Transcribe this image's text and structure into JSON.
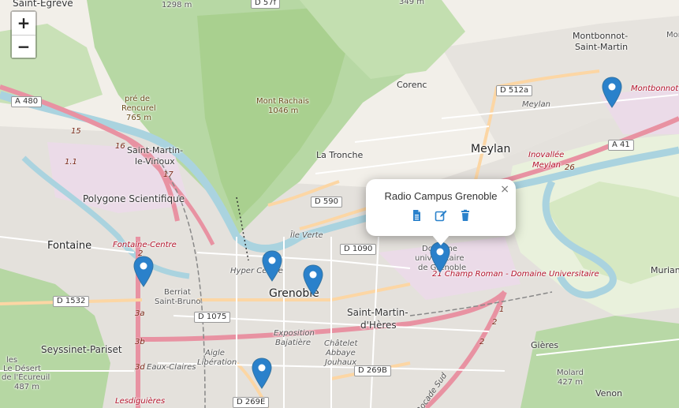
{
  "map": {
    "zoom_in_label": "+",
    "zoom_out_label": "−",
    "colors": {
      "marker": "#2a81cb",
      "marker_dark": "#3274a3",
      "motorway": "#e892a2",
      "trunk": "#f9b29c",
      "forest": "#add19e",
      "water": "#aad3df",
      "urban": "#e0dfdf"
    }
  },
  "labels": {
    "saint_egreve": "Saint-Égrève",
    "alt_1298": "1298 m",
    "d57f": "D 57f",
    "alt_349": "349 m",
    "mont_fragment": "Mont",
    "montbonnot": "Montbonnot-",
    "saint_martin": "Saint-Martin",
    "a480": "A 480",
    "pre_de": "pré de",
    "rencurel": "Rencurel",
    "alt_765": "765 m",
    "mont_rachais": "Mont Rachais",
    "alt_1046": "1046 m",
    "corenc": "Corenc",
    "d512a": "D 512a",
    "meylan_small": "Meylan",
    "montbonnot_red": "Montbonnot -",
    "n15": "15",
    "n16": "16",
    "n11": "1.1",
    "saint_martin_le": "Saint-Martin-",
    "le_vinoux": "le-Vinoux",
    "n17": "17",
    "la_tronche": "La Tronche",
    "meylan": "Meylan",
    "inovallee": "Inovallée",
    "meylan_red": "Meylan",
    "n26": "26",
    "a41": "A 41",
    "polygone": "Polygone Scientifique",
    "d590": "D 590",
    "ile_verte": "Île Verte",
    "fontaine": "Fontaine",
    "fontaine_centre": "Fontaine-Centre",
    "n2": "2",
    "hyper_centre": "Hyper Centre",
    "d1090": "D 1090",
    "domaine": "Domaine",
    "universitaire": "universitaire",
    "de_grenoble": "de Grenoble",
    "champ_roman": "21 Champ Roman - Domaine Universitaire",
    "murian": "Murian",
    "d1532": "D 1532",
    "berriat": "Berriat",
    "saint_bruno": "Saint-Bruno",
    "grenoble": "Grenoble",
    "d1075": "D 1075",
    "saint_martin_d": "Saint-Martin-",
    "d_heres": "d'Hères",
    "n3a": "3a",
    "n3b": "3b",
    "n3d": "3d",
    "n1": "1",
    "n2b": "2",
    "n2c": "2",
    "seyssinet": "Seyssinet-Pariset",
    "exposition": "Exposition",
    "bajatiere": "Bajatière",
    "chatelet": "Châtelet",
    "abbaye": "Abbaye",
    "jouhaux": "Jouhaux",
    "gieres": "Gières",
    "les": "les",
    "le_desert": "Le Désert",
    "de_lecureuil": "de l'Écureuil",
    "alt_487": "487 m",
    "eaux_claires": "Eaux-Claires",
    "aigle": "Aigle",
    "liberation": "Libération",
    "d269b": "D 269B",
    "molard": "Molard",
    "alt_427": "427 m",
    "venon": "Venon",
    "lesdiguieres": "Lesdiguières",
    "d269e": "D 269E",
    "rocade_sud": "Rocade Sud"
  },
  "popup": {
    "title": "Radio Campus Grenoble",
    "close_label": "×",
    "actions": [
      "document-icon",
      "edit-icon",
      "trash-icon"
    ]
  },
  "markers": [
    {
      "name": "marker-montbonnot"
    },
    {
      "name": "marker-fontaine"
    },
    {
      "name": "marker-hyper-centre"
    },
    {
      "name": "marker-grenoble"
    },
    {
      "name": "marker-radio-campus"
    },
    {
      "name": "marker-south"
    }
  ]
}
